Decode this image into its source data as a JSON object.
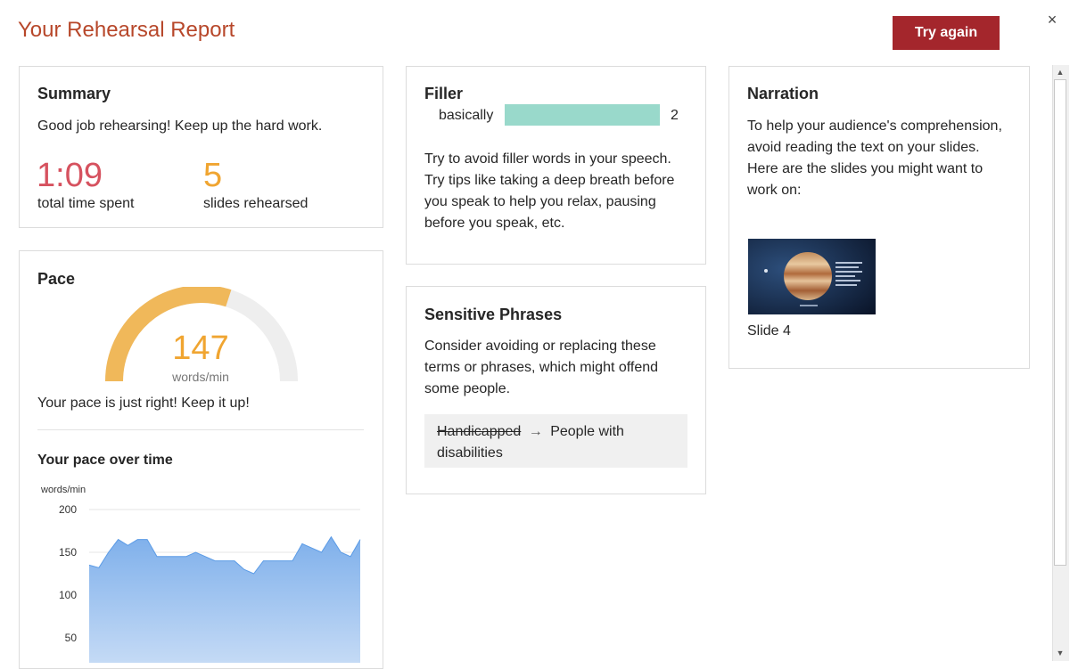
{
  "header": {
    "title": "Your Rehearsal Report",
    "try_again_label": "Try again",
    "close_glyph": "×"
  },
  "summary": {
    "title": "Summary",
    "message": "Good job rehearsing! Keep up the hard work.",
    "time_value": "1:09",
    "time_label": "total time spent",
    "slides_value": "5",
    "slides_label": "slides rehearsed",
    "time_color": "#d6525f",
    "slides_color": "#f0a531"
  },
  "pace": {
    "title": "Pace",
    "value": "147",
    "unit": "words/min",
    "gauge_fraction": 0.6,
    "message": "Your pace is just right! Keep it up!",
    "gauge_color": "#f0b85a",
    "track_color": "#eeeeee",
    "over_time_title": "Your pace over time"
  },
  "filler": {
    "title": "Filler",
    "items": [
      {
        "word": "basically",
        "count": "2",
        "fraction": 1.0
      }
    ],
    "bar_color": "#99d9cb",
    "tip": "Try to avoid filler words in your speech. Try tips like taking a deep breath before you speak to help you relax, pausing before you speak, etc."
  },
  "sensitive": {
    "title": "Sensitive Phrases",
    "message": "Consider avoiding or replacing these terms or phrases, which might offend some people.",
    "original": "Handicapped",
    "arrow": "→",
    "replacement": "People with disabilities"
  },
  "narration": {
    "title": "Narration",
    "message_line1": "To help your audience's comprehension, avoid reading the text on your slides.",
    "message_line2": "Here are the slides you might want to work on:",
    "slide_label": "Slide 4"
  },
  "chart_data": {
    "type": "area",
    "ylabel": "words/min",
    "ylim": [
      0,
      200
    ],
    "yticks": [
      "200",
      "150",
      "100",
      "50"
    ],
    "values": [
      135,
      132,
      150,
      165,
      158,
      165,
      165,
      145,
      145,
      145,
      145,
      150,
      145,
      140,
      140,
      140,
      130,
      125,
      140,
      140,
      140,
      140,
      160,
      155,
      150,
      168,
      150,
      145,
      165
    ],
    "fill_top": "#7fb0eb",
    "fill_bottom": "#c9ddf6"
  },
  "scrollbar": {
    "up_glyph": "▲",
    "down_glyph": "▼"
  }
}
